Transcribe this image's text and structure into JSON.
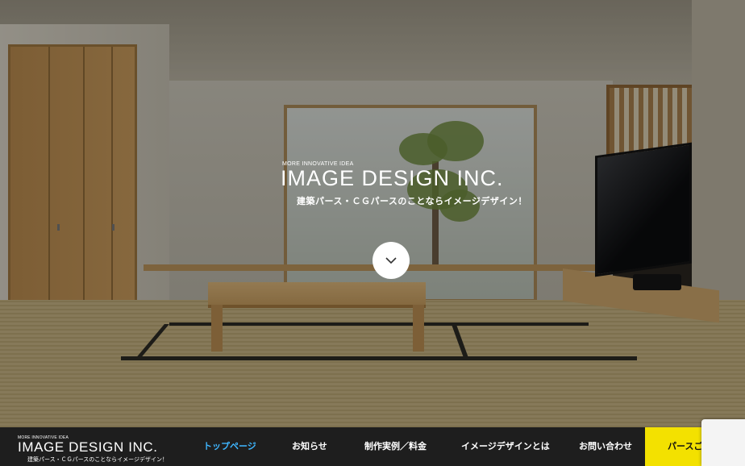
{
  "hero": {
    "kicker": "MORE INNOVATIVE IDEA",
    "title": "IMAGE DESIGN INC.",
    "subtitle": "建築パース・ＣＧパースのことならイメージデザイン！",
    "scroll_icon": "chevron-down-icon"
  },
  "nav": {
    "logo_kicker": "MORE INNOVATIVE IDEA",
    "logo_title": "IMAGE DESIGN INC.",
    "logo_subtitle": "建築パース・ＣＧパースのことならイメージデザイン！",
    "items": [
      {
        "label": "トップページ"
      },
      {
        "label": "お知らせ"
      },
      {
        "label": "制作実例／料金"
      },
      {
        "label": "イメージデザインとは"
      },
      {
        "label": "お問い合わせ"
      }
    ],
    "cta_label": "パースご注文フォーム"
  },
  "colors": {
    "active_nav": "#3fb6ff",
    "nav_bg": "#1e1e1e",
    "cta_bg": "#f3e100"
  }
}
